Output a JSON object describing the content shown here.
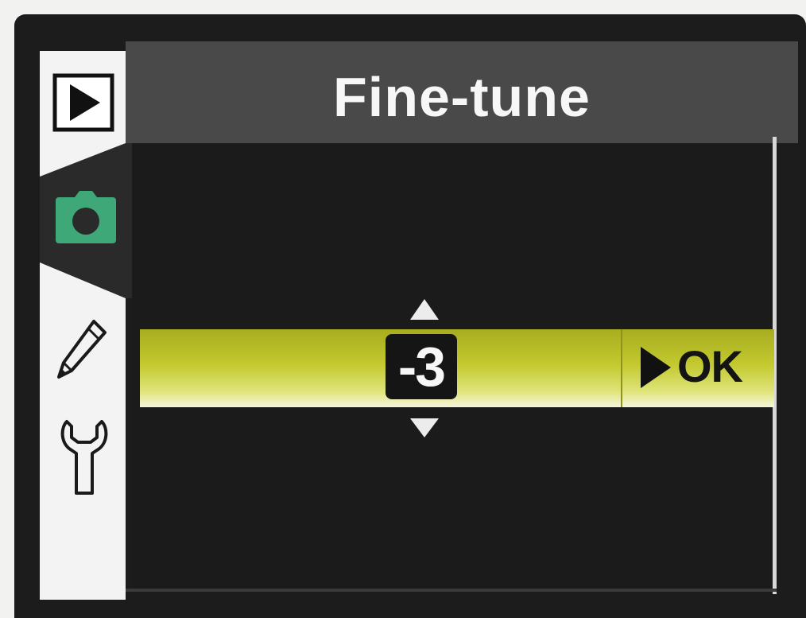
{
  "menu": {
    "title": "Fine-tune",
    "value": "-3",
    "confirm_label": "OK"
  },
  "sidebar": {
    "tabs": [
      {
        "icon": "playback-icon",
        "active": false
      },
      {
        "icon": "camera-icon",
        "active": true
      },
      {
        "icon": "pencil-icon",
        "active": false
      },
      {
        "icon": "wrench-icon",
        "active": false
      }
    ]
  },
  "colors": {
    "highlight": "#c3c92e",
    "camera_icon": "#3ea878",
    "title_bar": "#4a4949"
  }
}
